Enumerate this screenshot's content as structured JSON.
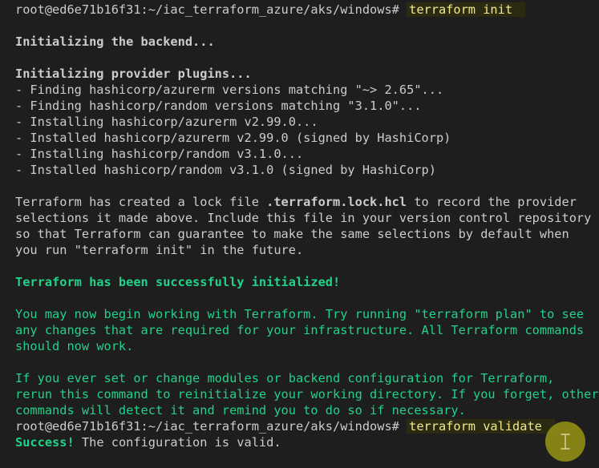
{
  "prompt1": {
    "text": "root@ed6e71b16f31:~/iac_terraform_azure/aks/windows# ",
    "command": "terraform init"
  },
  "init": {
    "backend": "Initializing the backend...",
    "plugins": "Initializing provider plugins...",
    "steps": [
      "- Finding hashicorp/azurerm versions matching \"~> 2.65\"...",
      "- Finding hashicorp/random versions matching \"3.1.0\"...",
      "- Installing hashicorp/azurerm v2.99.0...",
      "- Installed hashicorp/azurerm v2.99.0 (signed by HashiCorp)",
      "- Installing hashicorp/random v3.1.0...",
      "- Installed hashicorp/random v3.1.0 (signed by HashiCorp)"
    ]
  },
  "lock": {
    "line1_pre": "Terraform has created a lock file ",
    "line1_file": ".terraform.lock.hcl",
    "line1_post": " to record the provider",
    "line2": "selections it made above. Include this file in your version control repository",
    "line3": "so that Terraform can guarantee to make the same selections by default when",
    "line4": "you run \"terraform init\" in the future."
  },
  "success_init": "Terraform has been successfully initialized!",
  "next_steps": [
    "You may now begin working with Terraform. Try running \"terraform plan\" to see",
    "any changes that are required for your infrastructure. All Terraform commands",
    "should now work."
  ],
  "reinit": [
    "If you ever set or change modules or backend configuration for Terraform,",
    "rerun this command to reinitialize your working directory. If you forget, other",
    "commands will detect it and remind you to do so if necessary."
  ],
  "prompt2": {
    "text": "root@ed6e71b16f31:~/iac_terraform_azure/aks/windows# ",
    "command": "terraform validate"
  },
  "validate": {
    "success": "Success!",
    "message": " The configuration is valid."
  },
  "cursor": {
    "glyph": "I",
    "icon": "text-cursor-icon",
    "badge_color": "#8e8c16"
  },
  "colors": {
    "background": "#1e1e1e",
    "text": "#cccccc",
    "green": "#23d18b",
    "command_highlight": "#f2e88a"
  }
}
